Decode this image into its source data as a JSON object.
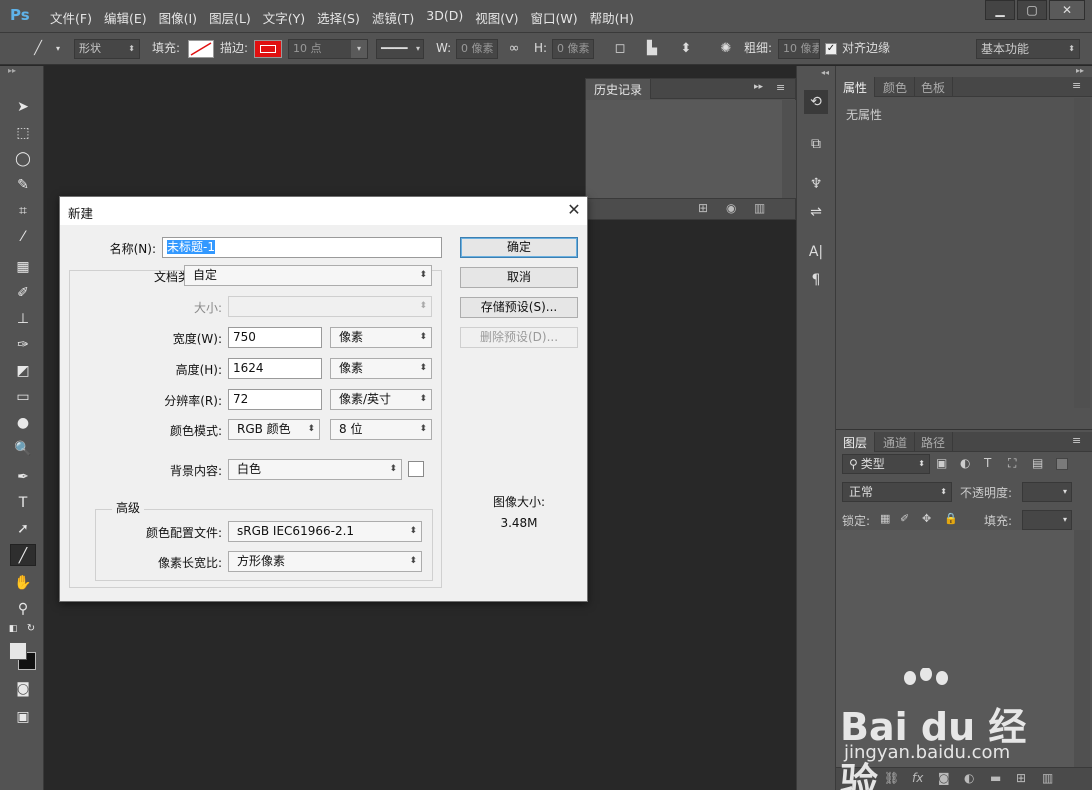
{
  "app": {
    "logo": "Ps"
  },
  "menu": [
    "文件(F)",
    "编辑(E)",
    "图像(I)",
    "图层(L)",
    "文字(Y)",
    "选择(S)",
    "滤镜(T)",
    "3D(D)",
    "视图(V)",
    "窗口(W)",
    "帮助(H)"
  ],
  "window": {
    "min": "▁",
    "max": "▢",
    "close": "✕"
  },
  "options": {
    "mode": "形状",
    "fill_label": "填充:",
    "stroke_label": "描边:",
    "stroke_size": "10 点",
    "w_label": "W:",
    "w_value": "0 像素",
    "h_label": "H:",
    "h_value": "0 像素",
    "weight_label": "粗细:",
    "weight_value": "10 像素",
    "align_edges": "对齐边缘",
    "workspace": "基本功能"
  },
  "history_panel": {
    "title": "历史记录"
  },
  "properties_panel": {
    "tabs": [
      "属性",
      "颜色",
      "色板"
    ],
    "empty_text": "无属性"
  },
  "layers_panel": {
    "tabs": [
      "图层",
      "通道",
      "路径"
    ],
    "filter": "类型",
    "blend_mode": "正常",
    "opacity_label": "不透明度:",
    "lock_label": "锁定:",
    "fill_label": "填充:"
  },
  "dialog": {
    "title": "新建",
    "name_label": "名称(N):",
    "name_value": "未标题-1",
    "preset_label": "文档类型:",
    "preset_value": "自定",
    "size_label": "大小:",
    "width_label": "宽度(W):",
    "width_value": "750",
    "width_unit": "像素",
    "height_label": "高度(H):",
    "height_value": "1624",
    "height_unit": "像素",
    "resolution_label": "分辨率(R):",
    "resolution_value": "72",
    "resolution_unit": "像素/英寸",
    "color_mode_label": "颜色模式:",
    "color_mode_value": "RGB 颜色",
    "bit_depth": "8 位",
    "background_label": "背景内容:",
    "background_value": "白色",
    "advanced_label": "高级",
    "color_profile_label": "颜色配置文件:",
    "color_profile_value": "sRGB IEC61966-2.1",
    "pixel_aspect_label": "像素长宽比:",
    "pixel_aspect_value": "方形像素",
    "ok": "确定",
    "cancel": "取消",
    "save_preset": "存储预设(S)...",
    "delete_preset": "删除预设(D)...",
    "image_size_label": "图像大小:",
    "image_size_value": "3.48M"
  },
  "watermark": {
    "brand": "Bai du 经验",
    "url": "jingyan.baidu.com"
  },
  "colors": {
    "stroke_red": "#e01010",
    "accent": "#3399ff",
    "ui_bg": "#535353"
  }
}
